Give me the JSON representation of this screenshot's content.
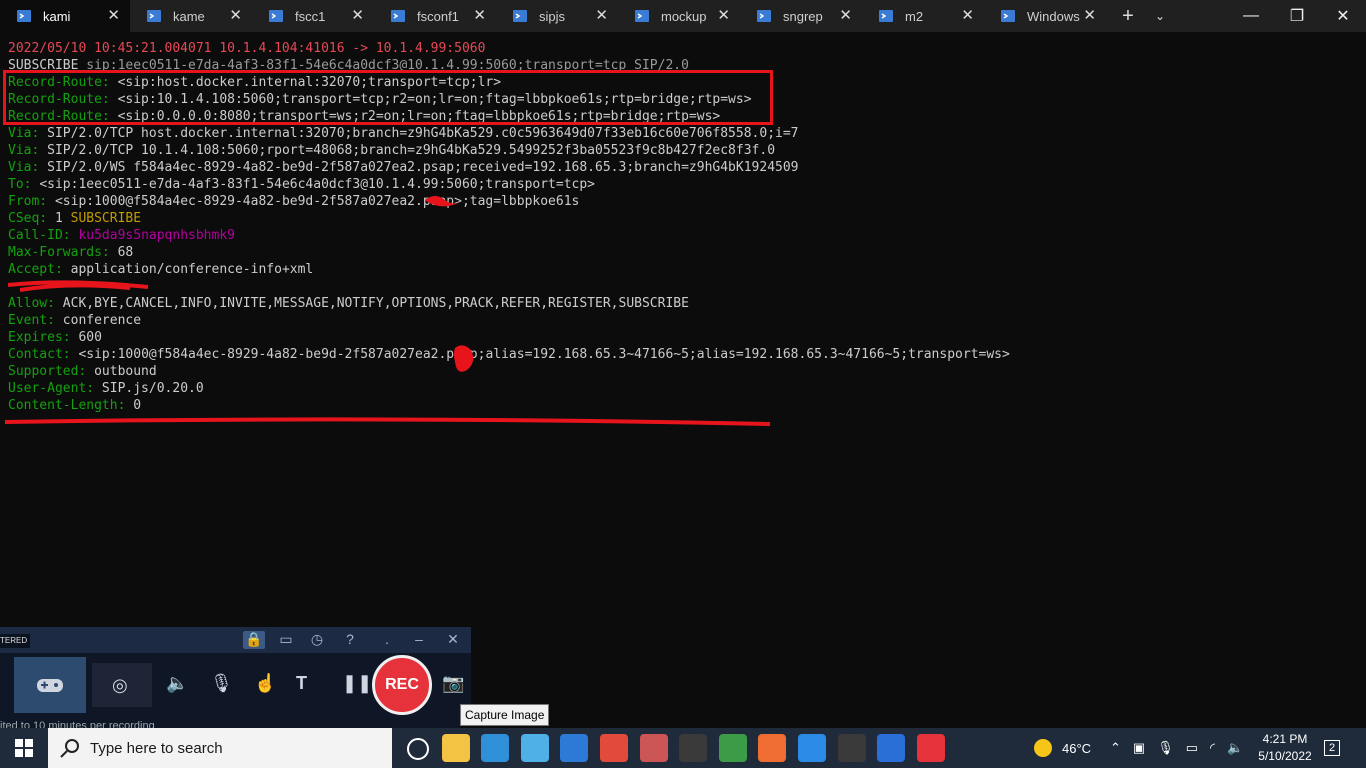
{
  "tabs": [
    {
      "label": "kami",
      "active": true
    },
    {
      "label": "kame",
      "active": false
    },
    {
      "label": "fscc1",
      "active": false
    },
    {
      "label": "fsconf1",
      "active": false
    },
    {
      "label": "sipjs",
      "active": false
    },
    {
      "label": "mockup",
      "active": false
    },
    {
      "label": "sngrep",
      "active": false
    },
    {
      "label": "m2",
      "active": false
    },
    {
      "label": "Windows",
      "active": false
    }
  ],
  "tab_close": "✕",
  "new_tab": "+",
  "tab_dropdown": "⌄",
  "window_controls": {
    "minimize": "—",
    "maximize": "❐",
    "close": "✕"
  },
  "colors": {
    "header_green": "#13a10e",
    "first_line_red": "#e74856",
    "method_yellow": "#c19c00",
    "callid_magenta": "#b4009e",
    "annotation_red": "#e8141c"
  },
  "terminal": {
    "line1": "2022/05/10 10:45:21.004071 10.1.4.104:41016 -> 10.1.4.99:5060",
    "request_method": "SUBSCRIBE",
    "request_uri": " sip:1eec0511-e7da-4af3-83f1-54e6c4a0dcf3@10.1.4.99:5060;transport=tcp SIP/2.0",
    "lines": [
      {
        "name": "Record-Route: ",
        "value": "<sip:host.docker.internal:32070;transport=tcp;lr>"
      },
      {
        "name": "Record-Route: ",
        "value": "<sip:10.1.4.108:5060;transport=tcp;r2=on;lr=on;ftag=lbbpkoe61s;rtp=bridge;rtp=ws>"
      },
      {
        "name": "Record-Route: ",
        "value": "<sip:0.0.0.0:8080;transport=ws;r2=on;lr=on;ftag=lbbpkoe61s;rtp=bridge;rtp=ws>"
      },
      {
        "name": "Via: ",
        "value": "SIP/2.0/TCP host.docker.internal:32070;branch=z9hG4bKa529.c0c5963649d07f33eb16c60e706f8558.0;i=7"
      },
      {
        "name": "Via: ",
        "value": "SIP/2.0/TCP 10.1.4.108:5060;rport=48068;branch=z9hG4bKa529.5499252f3ba05523f9c8b427f2ec8f3f.0"
      },
      {
        "name": "Via: ",
        "value": "SIP/2.0/WS f584a4ec-8929-4a82-be9d-2f587a027ea2.psap;received=192.168.65.3;branch=z9hG4bK1924509"
      },
      {
        "name": "To: ",
        "value": "<sip:1eec0511-e7da-4af3-83f1-54e6c4a0dcf3@10.1.4.99:5060;transport=tcp>"
      },
      {
        "name": "From: ",
        "value": "<sip:1000@f584a4ec-8929-4a82-be9d-2f587a027ea2.psap>;tag=lbbpkoe61s"
      },
      {
        "name": "CSeq: ",
        "value": "1 ",
        "extra": "SUBSCRIBE"
      },
      {
        "name": "Call-ID: ",
        "value": "ku5da9s5napqnhsbhmk9"
      },
      {
        "name": "Max-Forwards: ",
        "value": "68"
      },
      {
        "name": "Accept: ",
        "value": "application/conference-info+xml"
      },
      {
        "name": "",
        "value": ""
      },
      {
        "name": "Allow: ",
        "value": "ACK,BYE,CANCEL,INFO,INVITE,MESSAGE,NOTIFY,OPTIONS,PRACK,REFER,REGISTER,SUBSCRIBE"
      },
      {
        "name": "Event: ",
        "value": "conference"
      },
      {
        "name": "Expires: ",
        "value": "600"
      },
      {
        "name": "Contact: ",
        "value": "<sip:1000@f584a4ec-8929-4a82-be9d-2f587a027ea2.psap;alias=192.168.65.3~47166~5;alias=192.168.65.3~47166~5;transport=ws>"
      },
      {
        "name": "Supported: ",
        "value": "outbound"
      },
      {
        "name": "User-Agent: ",
        "value": "SIP.js/0.20.0"
      },
      {
        "name": "Content-Length: ",
        "value": "0"
      }
    ]
  },
  "recorder": {
    "status_tag": "TERED",
    "rec_label": "REC",
    "bottom_text": "ited to 10 minutes per recording",
    "tooltip": "Capture Image"
  },
  "taskbar": {
    "search_placeholder": "Type here to search",
    "weather": "46°C",
    "time": "4:21 PM",
    "date": "5/10/2022",
    "notification_count": "2",
    "icons": [
      "task-view-icon",
      "file-explorer-icon",
      "edge-icon",
      "store-icon",
      "mail-icon",
      "chrome-icon",
      "chrome-profile-icon",
      "terminal-icon",
      "sheets-icon",
      "postman-icon",
      "vscode-icon",
      "cmd-icon",
      "phone-icon",
      "recorder-icon"
    ]
  }
}
